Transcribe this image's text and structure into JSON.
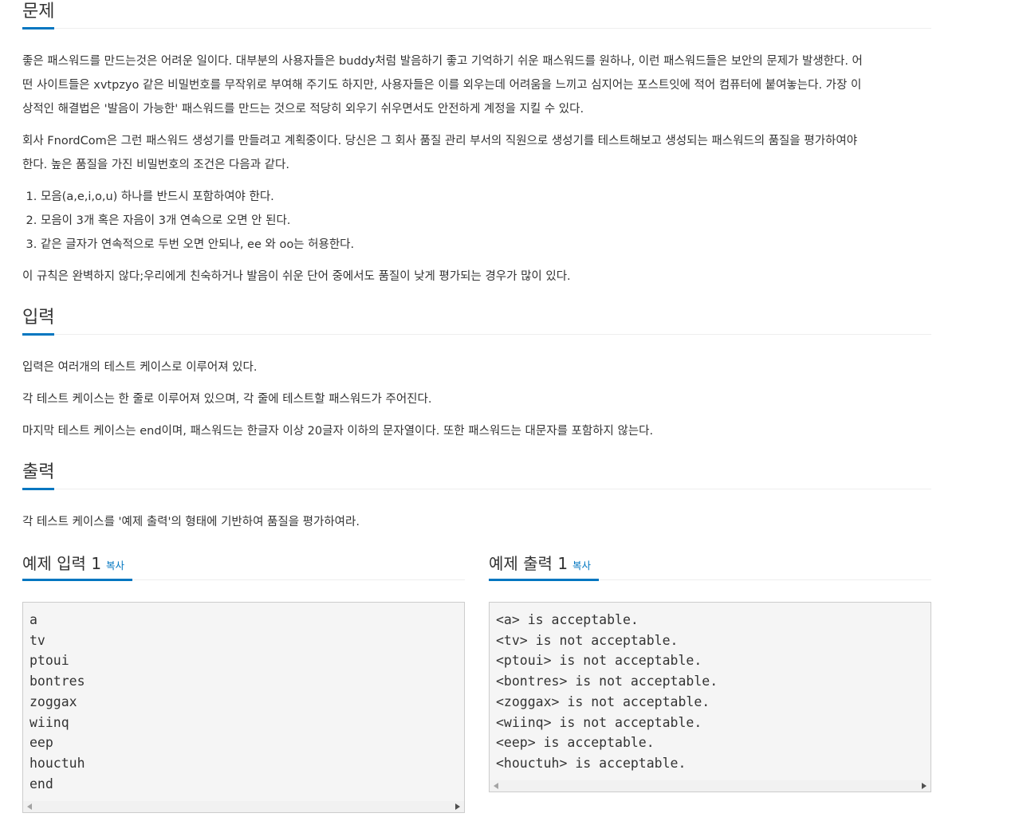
{
  "problem": {
    "heading": "문제",
    "p1_line1": "좋은 패스워드를 만드는것은 어려운 일이다. 대부분의 사용자들은 buddy처럼 발음하기 좋고 기억하기 쉬운 패스워드를 원하나, 이런 패스워드들은 보안의 문제가 발생한다. 어",
    "p1_line2": "떤 사이트들은 xvtpzyo 같은 비밀번호를 무작위로 부여해 주기도 하지만, 사용자들은 이를 외우는데 어려움을 느끼고 심지어는 포스트잇에 적어 컴퓨터에 붙여놓는다. 가장 이",
    "p1_line3": "상적인 해결법은 '발음이 가능한' 패스워드를 만드는 것으로 적당히 외우기 쉬우면서도 안전하게 계정을 지킬 수 있다.",
    "p2_line1": "회사 FnordCom은 그런 패스워드 생성기를 만들려고 계획중이다. 당신은 그 회사 품질 관리 부서의 직원으로 생성기를 테스트해보고 생성되는 패스워드의 품질을 평가하여야",
    "p2_line2": "한다. 높은 품질을 가진 비밀번호의 조건은 다음과 같다.",
    "rules": [
      "모음(a,e,i,o,u) 하나를 반드시 포함하여야 한다.",
      "모음이 3개 혹은 자음이 3개 연속으로 오면 안 된다.",
      "같은 글자가 연속적으로 두번 오면 안되나, ee 와 oo는 허용한다."
    ],
    "p3": "이 규칙은 완벽하지 않다;우리에게 친숙하거나 발음이 쉬운 단어 중에서도 품질이 낮게 평가되는 경우가 많이 있다."
  },
  "input": {
    "heading": "입력",
    "p1": "입력은 여러개의 테스트 케이스로 이루어져 있다.",
    "p2": "각 테스트 케이스는 한 줄로 이루어져 있으며, 각 줄에 테스트할 패스워드가 주어진다.",
    "p3": "마지막 테스트 케이스는 end이며, 패스워드는 한글자 이상 20글자 이하의 문자열이다. 또한 패스워드는 대문자를 포함하지 않는다."
  },
  "output": {
    "heading": "출력",
    "p1": "각 테스트 케이스를 '예제 출력'의 형태에 기반하여 품질을 평가하여라."
  },
  "sample_input": {
    "title": "예제 입력 1",
    "copy": "복사",
    "content": "a\ntv\nptoui\nbontres\nzoggax\nwiinq\neep\nhouctuh\nend"
  },
  "sample_output": {
    "title": "예제 출력 1",
    "copy": "복사",
    "content": "<a> is acceptable.\n<tv> is not acceptable.\n<ptoui> is not acceptable.\n<bontres> is not acceptable.\n<zoggax> is not acceptable.\n<wiinq> is not acceptable.\n<eep> is acceptable.\n<houctuh> is acceptable."
  }
}
